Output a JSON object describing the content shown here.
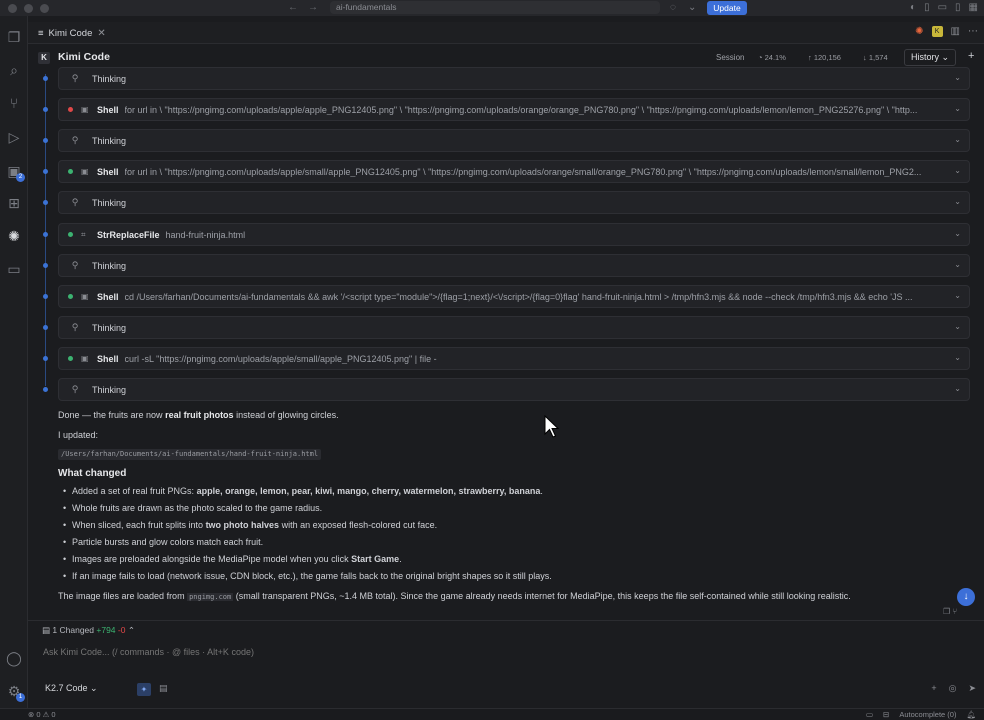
{
  "window": {
    "search_text": "ai-fundamentals",
    "update_label": "Update"
  },
  "tab": {
    "label": "Kimi Code"
  },
  "panel": {
    "logo": "K",
    "title": "Kimi Code",
    "session_label": "Session",
    "context_pct": "24.1%",
    "tokens_in": "120,156",
    "tokens_out": "1,574",
    "history_label": "History"
  },
  "steps": [
    {
      "kind": "thinking",
      "label": "Thinking"
    },
    {
      "kind": "tool",
      "status": "error",
      "label": "Shell",
      "cmd": "for url in \\ \"https://pngimg.com/uploads/apple/apple_PNG12405.png\" \\ \"https://pngimg.com/uploads/orange/orange_PNG780.png\" \\ \"https://pngimg.com/uploads/lemon/lemon_PNG25276.png\" \\ \"http..."
    },
    {
      "kind": "thinking",
      "label": "Thinking"
    },
    {
      "kind": "tool",
      "status": "ok",
      "label": "Shell",
      "cmd": "for url in \\ \"https://pngimg.com/uploads/apple/small/apple_PNG12405.png\" \\ \"https://pngimg.com/uploads/orange/small/orange_PNG780.png\" \\ \"https://pngimg.com/uploads/lemon/small/lemon_PNG2..."
    },
    {
      "kind": "thinking",
      "label": "Thinking"
    },
    {
      "kind": "tool",
      "status": "ok",
      "label": "StrReplaceFile",
      "cmd": "hand-fruit-ninja.html"
    },
    {
      "kind": "thinking",
      "label": "Thinking"
    },
    {
      "kind": "tool",
      "status": "ok",
      "label": "Shell",
      "cmd": "cd /Users/farhan/Documents/ai-fundamentals && awk '/<script type=\"module\">/{flag=1;next}/<\\/script>/{flag=0}flag' hand-fruit-ninja.html > /tmp/hfn3.mjs && node --check /tmp/hfn3.mjs && echo 'JS ..."
    },
    {
      "kind": "thinking",
      "label": "Thinking"
    },
    {
      "kind": "tool",
      "status": "ok",
      "label": "Shell",
      "cmd": "curl -sL \"https://pngimg.com/uploads/apple/small/apple_PNG12405.png\" | file -"
    },
    {
      "kind": "thinking",
      "label": "Thinking"
    }
  ],
  "response": {
    "done_pre": "Done — the fruits are now ",
    "done_bold": "real fruit photos",
    "done_post": " instead of glowing circles.",
    "updated": "I updated:",
    "path": "/Users/farhan/Documents/ai-fundamentals/hand-fruit-ninja.html",
    "heading": "What changed",
    "b1_pre": "Added a set of real fruit PNGs: ",
    "b1_bold": "apple, orange, lemon, pear, kiwi, mango, cherry, watermelon, strawberry, banana",
    "b1_post": ".",
    "b2": "Whole fruits are drawn as the photo scaled to the game radius.",
    "b3_pre": "When sliced, each fruit splits into ",
    "b3_bold": "two photo halves",
    "b3_post": " with an exposed flesh-colored cut face.",
    "b4": "Particle bursts and glow colors match each fruit.",
    "b5_pre": "Images are preloaded alongside the MediaPipe model when you click ",
    "b5_bold": "Start Game",
    "b5_post": ".",
    "b6": "If an image fails to load (network issue, CDN block, etc.), the game falls back to the original bright shapes so it still plays.",
    "final_pre": "The image files are loaded from ",
    "final_code": "pngimg.com",
    "final_post": " (small transparent PNGs, ~1.4 MB total). Since the game already needs internet for MediaPipe, this keeps the file self-contained while still looking realistic."
  },
  "changes": {
    "label": "1 Changed",
    "added": "+794",
    "removed": "-0"
  },
  "input": {
    "placeholder": "Ask Kimi Code... (/ commands · @ files · Alt+K code)"
  },
  "model": {
    "label": "K2.7 Code"
  },
  "status": {
    "left": "⊗ 0 ⚠ 0",
    "autocomplete": "Autocomplete (0)"
  }
}
